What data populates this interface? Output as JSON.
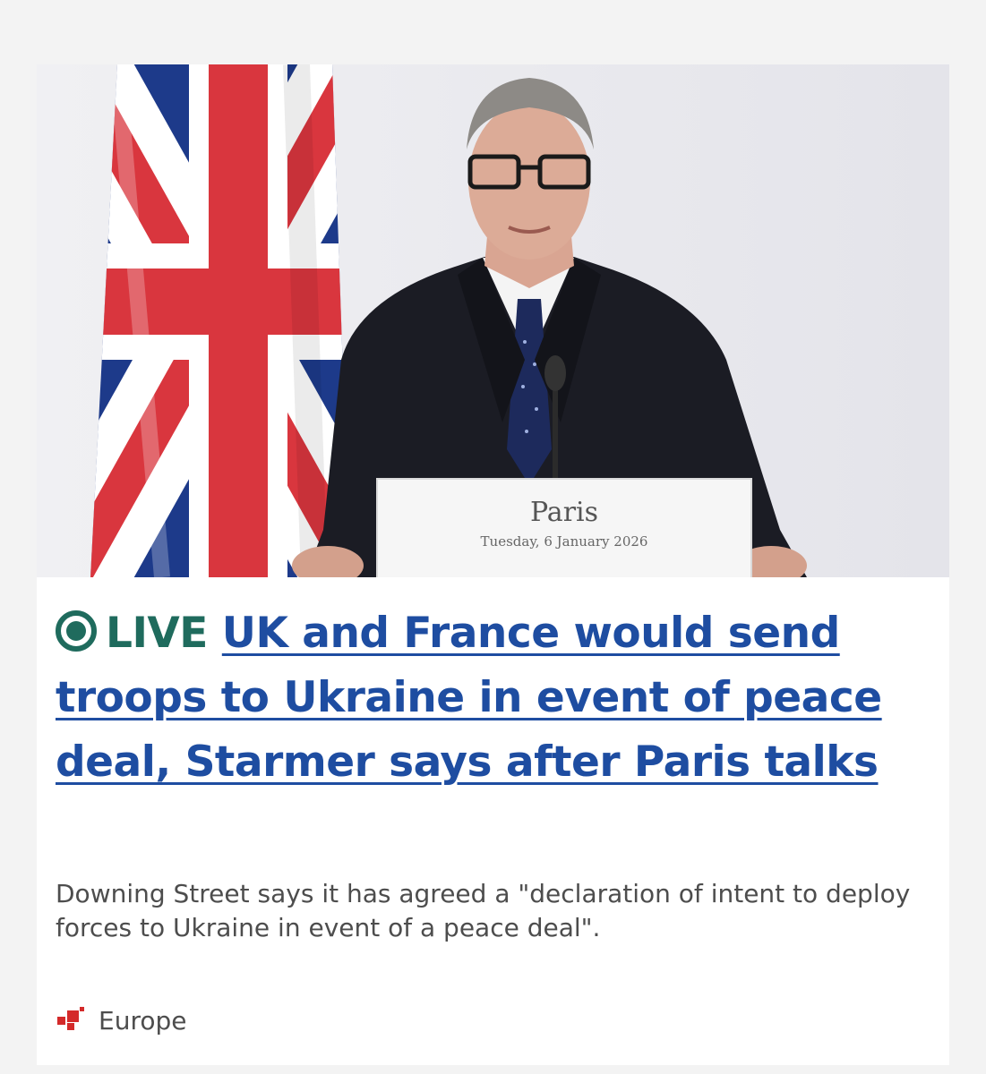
{
  "article": {
    "image": {
      "podium_city": "Paris",
      "podium_date": "Tuesday, 6 January 2026"
    },
    "live_label": "LIVE",
    "headline": "UK and France would send troops to Ukraine in event of peace deal, Starmer says after Paris talks",
    "summary": "Downing Street says it has agreed a \"declaration of intent to deploy forces to Ukraine in event of a peace deal\".",
    "topic": "Europe"
  },
  "colors": {
    "page_background": "#f3f3f3",
    "card_background": "#ffffff",
    "live_green": "#1f6b5d",
    "headline_link_blue": "#1e4da1",
    "summary_text": "#4d4d4d",
    "topic_icon_red": "#d42a2a"
  },
  "icons": {
    "live": "live-dot-icon",
    "topic": "europe-topic-icon"
  }
}
